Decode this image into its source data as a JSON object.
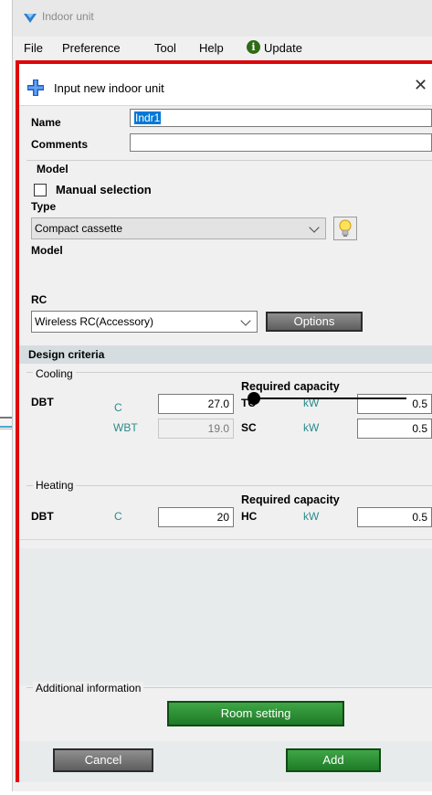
{
  "window": {
    "title": "Indoor unit",
    "menu": [
      "File",
      "Preference",
      "Tool",
      "Help",
      "Update"
    ]
  },
  "dialog": {
    "title": "Input new indoor unit",
    "name_label": "Name",
    "name_value": "Indr1",
    "comments_label": "Comments",
    "comments_value": ""
  },
  "model_section": {
    "group_label": "Model",
    "manual_selection_label": "Manual selection",
    "manual_selection_checked": false,
    "type_label": "Type",
    "type_value": "Compact cassette",
    "model_label": "Model",
    "rc_label": "RC",
    "rc_value": "Wireless RC(Accessory)",
    "options_button": "Options"
  },
  "design_criteria": {
    "header": "Design criteria",
    "cooling": {
      "group_label": "Cooling",
      "required_capacity_label": "Required capacity",
      "dbt_label": "DBT",
      "dbt_unit": "C",
      "dbt_value": "27.0",
      "wbt_label": "WBT",
      "wbt_value": "19.0",
      "tc_label": "TC",
      "tc_unit": "kW",
      "tc_value": "0.5",
      "sc_label": "SC",
      "sc_unit": "kW",
      "sc_value": "0.5"
    },
    "heating": {
      "group_label": "Heating",
      "required_capacity_label": "Required capacity",
      "dbt_label": "DBT",
      "dbt_unit": "C",
      "dbt_value": "20",
      "hc_label": "HC",
      "hc_unit": "kW",
      "hc_value": "0.5"
    }
  },
  "additional": {
    "group_label": "Additional information",
    "room_setting_button": "Room setting"
  },
  "footer": {
    "cancel_button": "Cancel",
    "add_button": "Add"
  },
  "colors": {
    "highlight_border": "#e0060c",
    "green_button": "#2a8f33",
    "section_header_bg": "#d6dde0"
  }
}
